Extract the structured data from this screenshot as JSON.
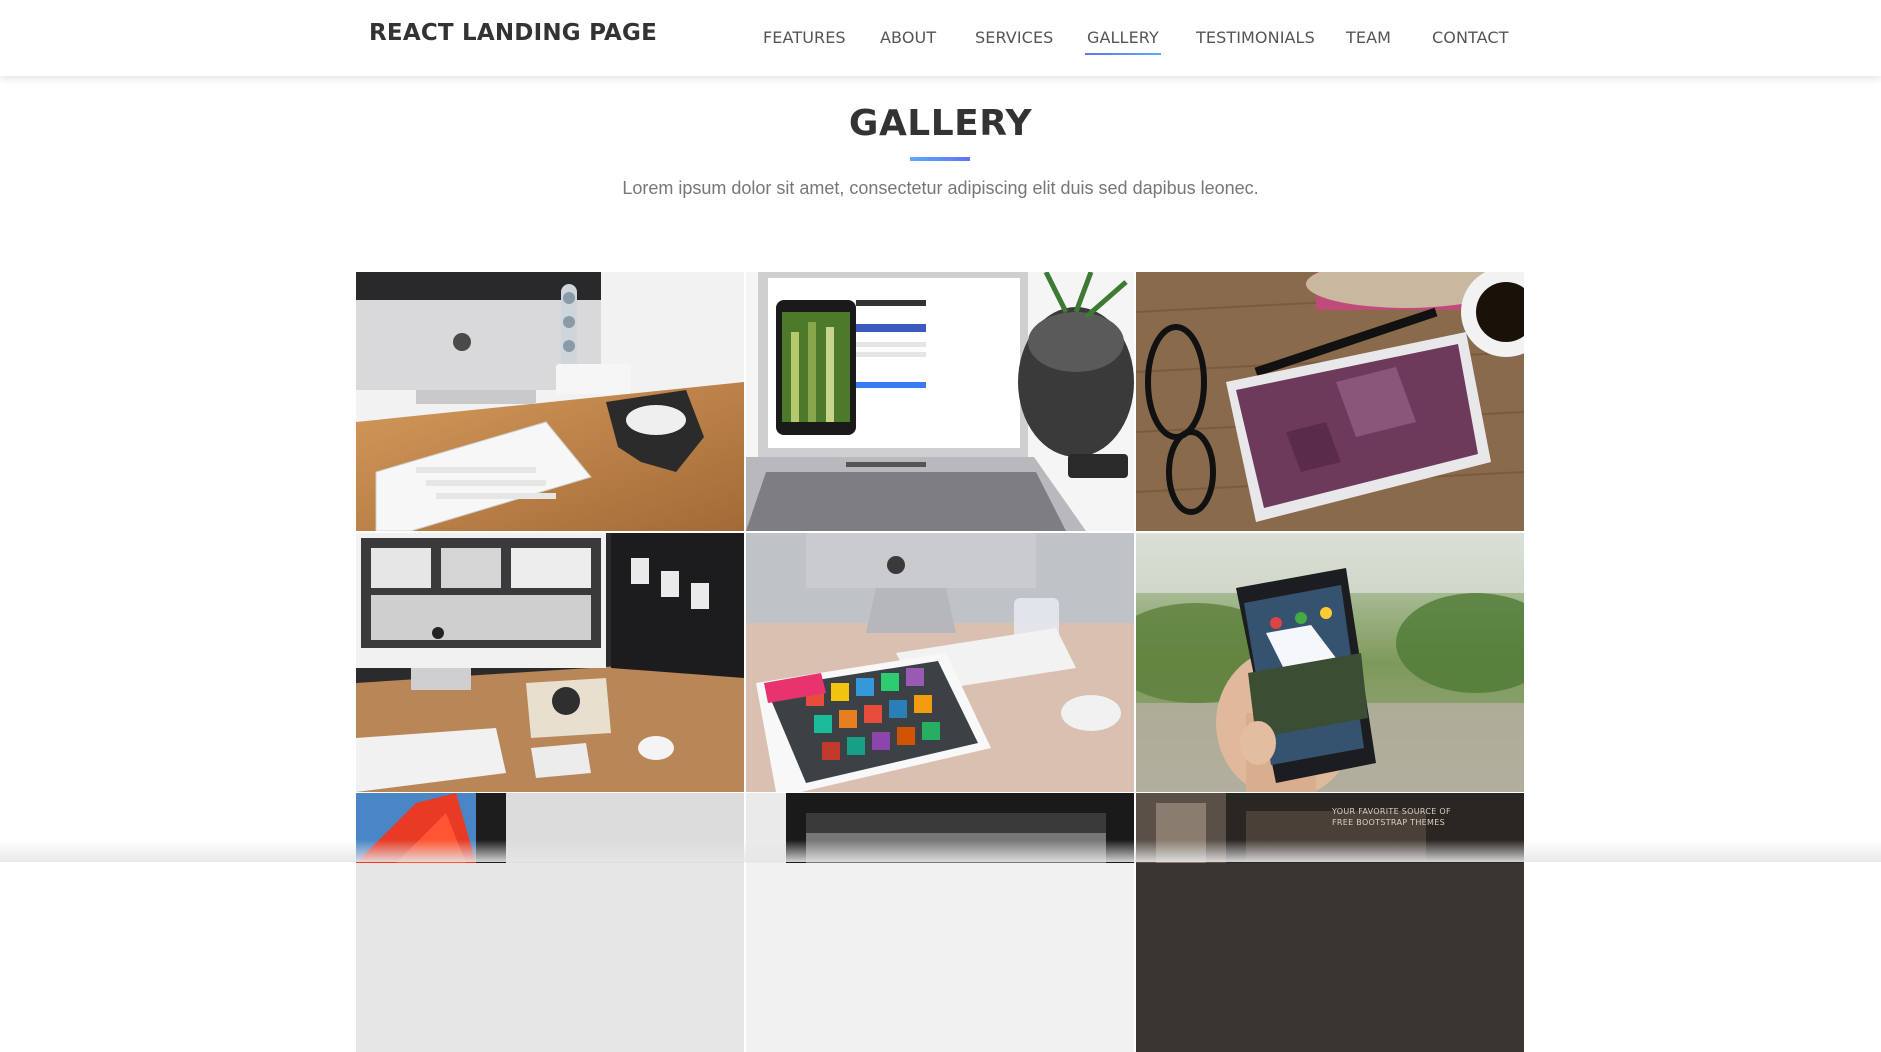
{
  "brand": "REACT LANDING PAGE",
  "nav": {
    "items": [
      {
        "label": "FEATURES"
      },
      {
        "label": "ABOUT"
      },
      {
        "label": "SERVICES"
      },
      {
        "label": "GALLERY",
        "active": true
      },
      {
        "label": "TESTIMONIALS"
      },
      {
        "label": "TEAM"
      },
      {
        "label": "CONTACT"
      }
    ]
  },
  "gallery": {
    "title": "GALLERY",
    "subtitle": "Lorem ipsum dolor sit amet, consectetur adipiscing elit duis sed dapibus leonec.",
    "images": [
      {
        "name": "gallery-image-imac-keyboard"
      },
      {
        "name": "gallery-image-laptop-instagram"
      },
      {
        "name": "gallery-image-tablet-glasses"
      },
      {
        "name": "gallery-image-imac-desk"
      },
      {
        "name": "gallery-image-tablet-apps"
      },
      {
        "name": "gallery-image-phone-hand"
      },
      {
        "name": "gallery-image-red-screen"
      },
      {
        "name": "gallery-image-dark-laptop"
      },
      {
        "name": "gallery-image-bootstrap-theme"
      }
    ],
    "tile9_caption_line1": "YOUR FAVORITE SOURCE OF",
    "tile9_caption_line2": "FREE BOOTSTRAP THEMES"
  },
  "colors": {
    "accent_start": "#5ca9fb",
    "accent_end": "#6372ff",
    "text": "#333333",
    "subtext": "#777777"
  }
}
